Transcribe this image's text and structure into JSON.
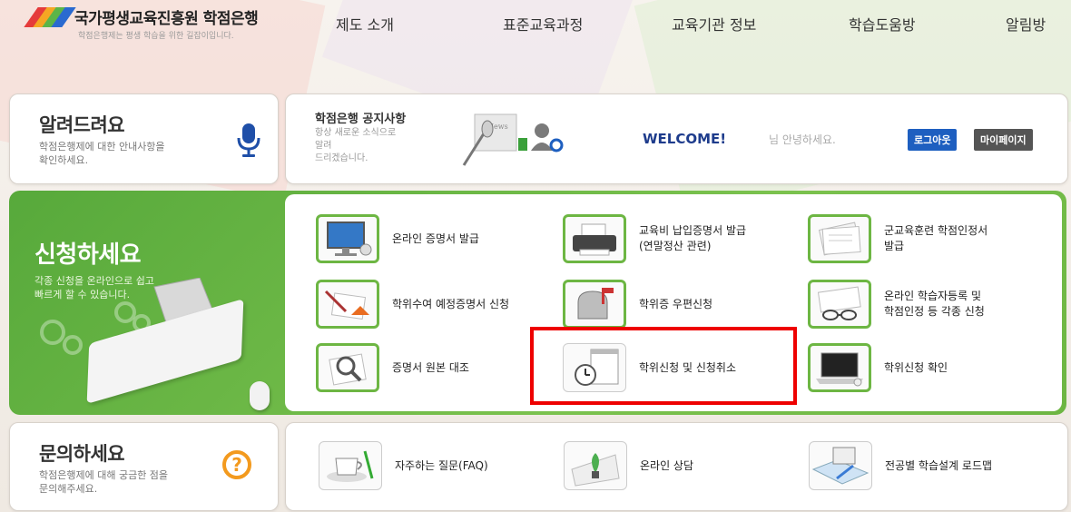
{
  "header": {
    "logo_title": "국가평생교육진흥원 학점은행",
    "logo_subtitle": "학점은행제는 평생 학습을 위한 길잡이입니다."
  },
  "nav": [
    "제도 소개",
    "표준교육과정",
    "교육기관 정보",
    "학습도움방",
    "알림방"
  ],
  "notice_box": {
    "title": "알려드려요",
    "desc": [
      "학점은행제에 대한 안내사항을",
      "확인하세요."
    ],
    "icon": "microphone-icon"
  },
  "notice_bar": {
    "title": "학점은행 공지사항",
    "desc": [
      "항상 새로운 소식으로 알려",
      "드리겠습니다."
    ],
    "welcome": "WELCOME!",
    "greeting": "님 안녕하세요.",
    "logout_label": "로그아웃",
    "mypage_label": "마이페이지"
  },
  "apply": {
    "title": "신청하세요",
    "desc": [
      "각종 신청을 온라인으로 쉽고",
      "빠르게 할 수 있습니다."
    ],
    "items": [
      {
        "label": [
          "온라인 증명서 발급"
        ],
        "icon": "monitor-icon"
      },
      {
        "label": [
          "교육비 납입증명서 발급",
          "(연말정산 관련)"
        ],
        "icon": "printer-icon"
      },
      {
        "label": [
          "군교육훈련 학점인정서",
          "발급"
        ],
        "icon": "papers-icon"
      },
      {
        "label": [
          "학위수여 예정증명서 신청"
        ],
        "icon": "certificate-icon"
      },
      {
        "label": [
          "학위증 우편신청"
        ],
        "icon": "mailbox-icon"
      },
      {
        "label": [
          "온라인 학습자등록 및",
          "학점인정 등 각종 신청"
        ],
        "icon": "glasses-icon"
      },
      {
        "label": [
          "증명서 원본 대조"
        ],
        "icon": "magnifier-icon"
      },
      {
        "label": [
          "학위신청 및 신청취소"
        ],
        "icon": "calendar-clock-icon"
      },
      {
        "label": [
          "학위신청 확인"
        ],
        "icon": "laptop-icon"
      }
    ]
  },
  "faq_box": {
    "title": "문의하세요",
    "desc": [
      "학점은행제에 대해 궁금한 점을",
      "문의해주세요."
    ],
    "icon": "question-icon"
  },
  "faq_row": [
    {
      "label": "자주하는 질문(FAQ)",
      "icon": "coffee-cup-icon"
    },
    {
      "label": "온라인 상담",
      "icon": "plant-icon"
    },
    {
      "label": "전공별 학습설계 로드맵",
      "icon": "roadmap-monitor-icon"
    }
  ],
  "colors": {
    "brand_blue": "#1e3c8c",
    "green": "#6db643",
    "highlight": "#e00000",
    "orange": "#f39a1e"
  }
}
